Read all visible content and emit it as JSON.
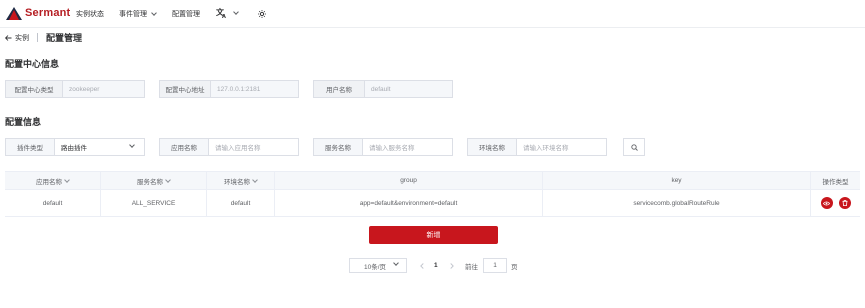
{
  "app": {
    "brand": "Sermant"
  },
  "nav": {
    "items": [
      {
        "label": "实例状态",
        "dropdown": false
      },
      {
        "label": "事件管理",
        "dropdown": true
      },
      {
        "label": "配置管理",
        "dropdown": false
      }
    ],
    "language_icon": "translate-icon",
    "theme_icon": "sun-icon"
  },
  "breadcrumb": {
    "back_label": "实例",
    "current": "配置管理"
  },
  "config_center": {
    "title": "配置中心信息",
    "fields": [
      {
        "label": "配置中心类型",
        "value": "zookeeper"
      },
      {
        "label": "配置中心地址",
        "value": "127.0.0.1:2181"
      },
      {
        "label": "用户名称",
        "value": "default"
      }
    ]
  },
  "config_info": {
    "title": "配置信息",
    "filters": [
      {
        "label": "插件类型",
        "value": "路由插件",
        "placeholder": ""
      },
      {
        "label": "应用名称",
        "value": "",
        "placeholder": "请输入应用名称"
      },
      {
        "label": "服务名称",
        "value": "",
        "placeholder": "请输入服务名称"
      },
      {
        "label": "环境名称",
        "value": "",
        "placeholder": "请输入环境名称"
      }
    ],
    "search_icon": "search-icon"
  },
  "table": {
    "columns": [
      "应用名称",
      "服务名称",
      "环境名称",
      "group",
      "key",
      "操作类型"
    ],
    "rows": [
      {
        "app": "default",
        "service": "ALL_SERVICE",
        "env": "default",
        "group": "app=default&environment=default",
        "key": "servicecomb.globalRouteRule"
      }
    ],
    "row_actions": [
      "view-icon",
      "delete-icon"
    ]
  },
  "add_button": {
    "label": "新增"
  },
  "pagination": {
    "page_size": "10条/页",
    "current_page": "1",
    "goto_label": "前往",
    "goto_value": "1",
    "page_unit": "页"
  },
  "colors": {
    "accent": "#c8161d",
    "brand": "#b51d22"
  }
}
